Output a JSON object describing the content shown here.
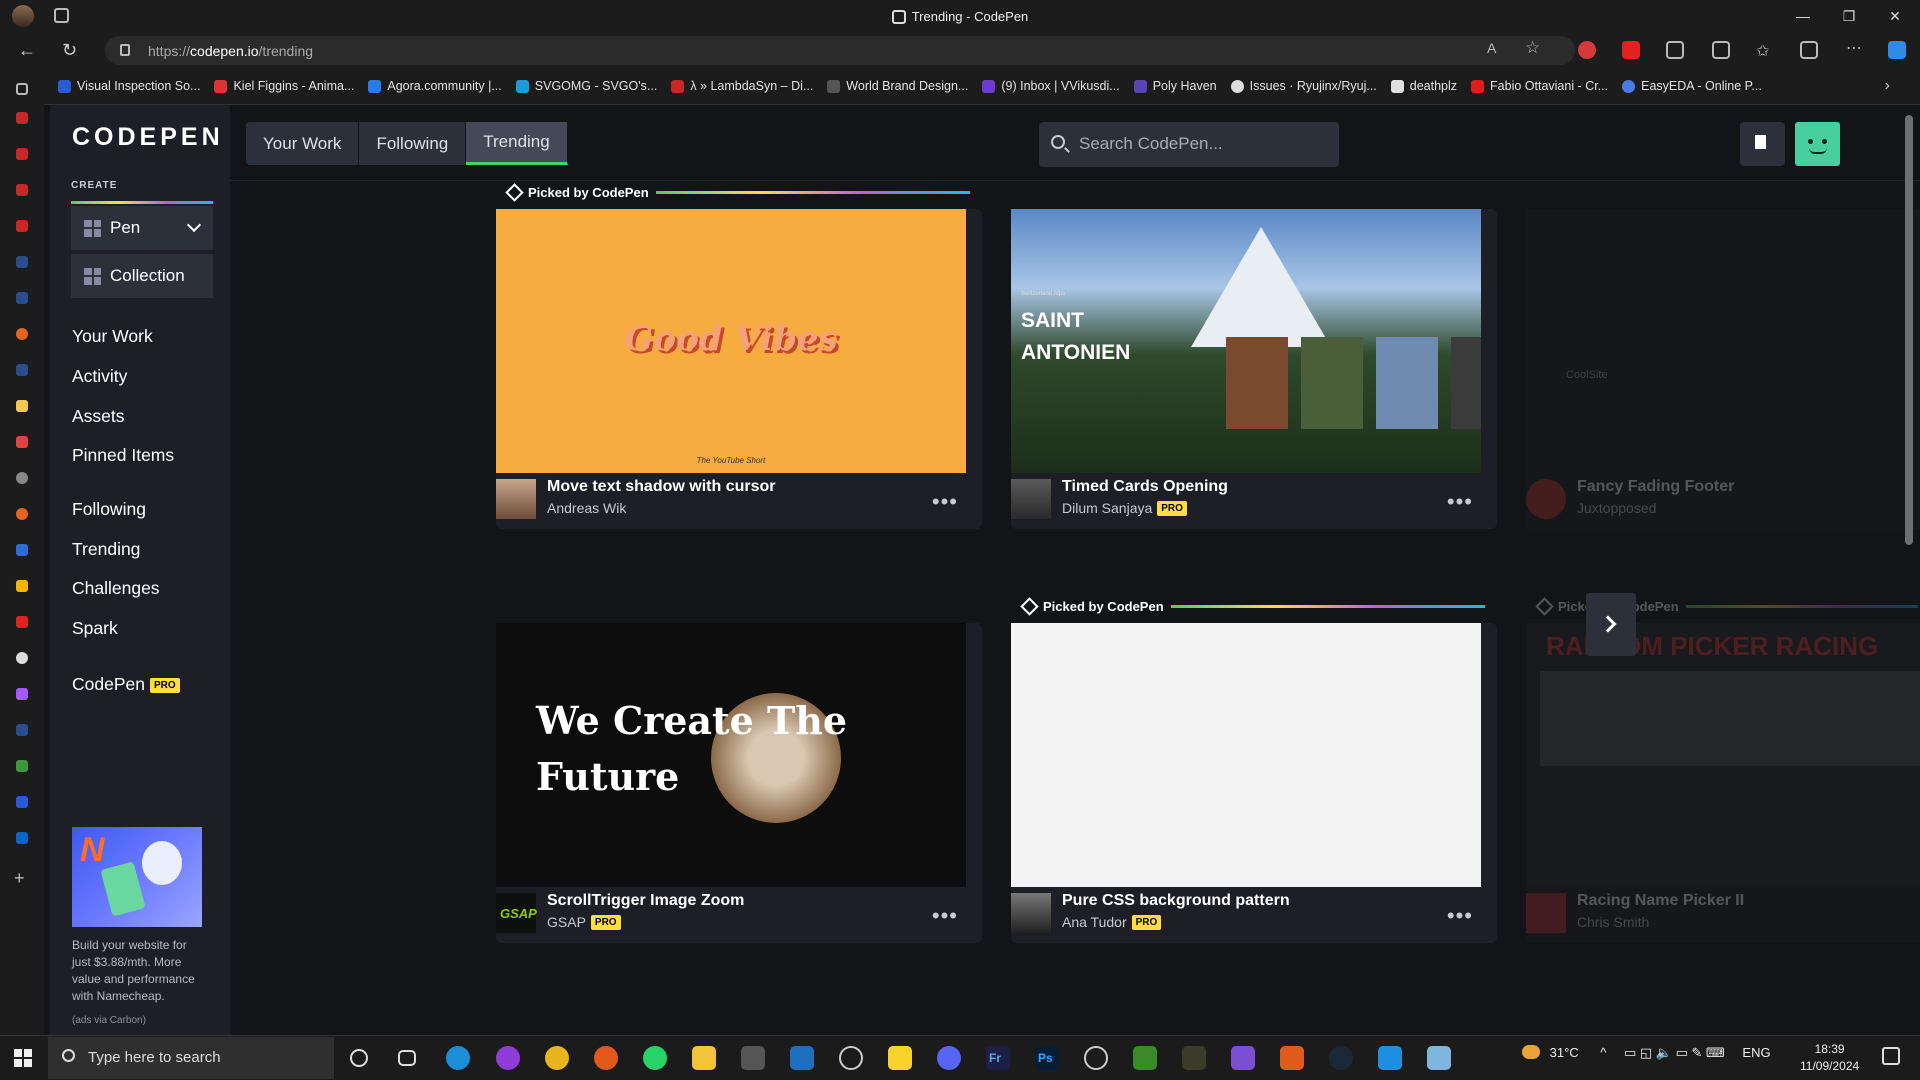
{
  "browser": {
    "tab_title": "Trending - CodePen",
    "url_prefix": "https://",
    "url_host": "codepen.io",
    "url_path": "/trending",
    "bookmarks": [
      "Visual Inspection So...",
      "Kiel Figgins - Anima...",
      "Agora.community |...",
      "SVGOMG - SVGO's...",
      "λ » LambdaSyn – Di...",
      "World Brand Design...",
      "(9) Inbox | VVikusdi...",
      "Poly Haven",
      "Issues · Ryujinx/Ryuj...",
      "deathplz",
      "Fabio Ottaviani - Cr...",
      "EasyEDA - Online P..."
    ]
  },
  "sidebar": {
    "logo": "CODEPEN",
    "create_label": "CREATE",
    "pen": "Pen",
    "collection": "Collection",
    "links": [
      "Your Work",
      "Activity",
      "Assets",
      "Pinned Items",
      "Following",
      "Trending",
      "Challenges",
      "Spark"
    ],
    "codepen_pro": "CodePen",
    "pro_badge": "PRO",
    "ad_text": "Build your website for just $3.88/mth. More value and performance with Namecheap.",
    "ad_via": "(ads via Carbon)"
  },
  "header": {
    "tabs": [
      "Your Work",
      "Following",
      "Trending"
    ],
    "active_tab": "Trending",
    "search_placeholder": "Search CodePen..."
  },
  "picked_label": "Picked by CodePen",
  "pens": [
    {
      "title": "Move text shadow with cursor",
      "author": "Andreas Wik",
      "pro": false,
      "picked": true,
      "thumb_text": "Good Vibes",
      "thumb_sub": "The YouTube Short"
    },
    {
      "title": "Timed Cards Opening",
      "author": "Dilum Sanjaya",
      "pro": true,
      "picked": false,
      "thumb_text": "SAINT ANTONIEN",
      "thumb_sub": "Switzerland Alps"
    },
    {
      "title": "Fancy Fading Footer",
      "author": "Juxtopposed",
      "pro": false,
      "picked": false,
      "thumb_text": "CoolSite"
    },
    {
      "title": "ScrollTrigger Image Zoom",
      "author": "GSAP",
      "pro": true,
      "picked": false,
      "thumb_text": "We Create The Future"
    },
    {
      "title": "Pure CSS background pattern",
      "author": "Ana Tudor",
      "pro": true,
      "picked": true
    },
    {
      "title": "Racing Name Picker II",
      "author": "Chris Smith",
      "pro": false,
      "picked": true,
      "thumb_text": "RANDOM PICKER RACING"
    }
  ],
  "taskbar": {
    "search_placeholder": "Type here to search",
    "weather": "31°C",
    "lang": "ENG",
    "time": "18:39",
    "date": "11/09/2024"
  },
  "colors": {
    "accent_green": "#47cf73",
    "pro_yellow": "#ffdd40",
    "bg": "#131417",
    "panel": "#1e1f26"
  }
}
